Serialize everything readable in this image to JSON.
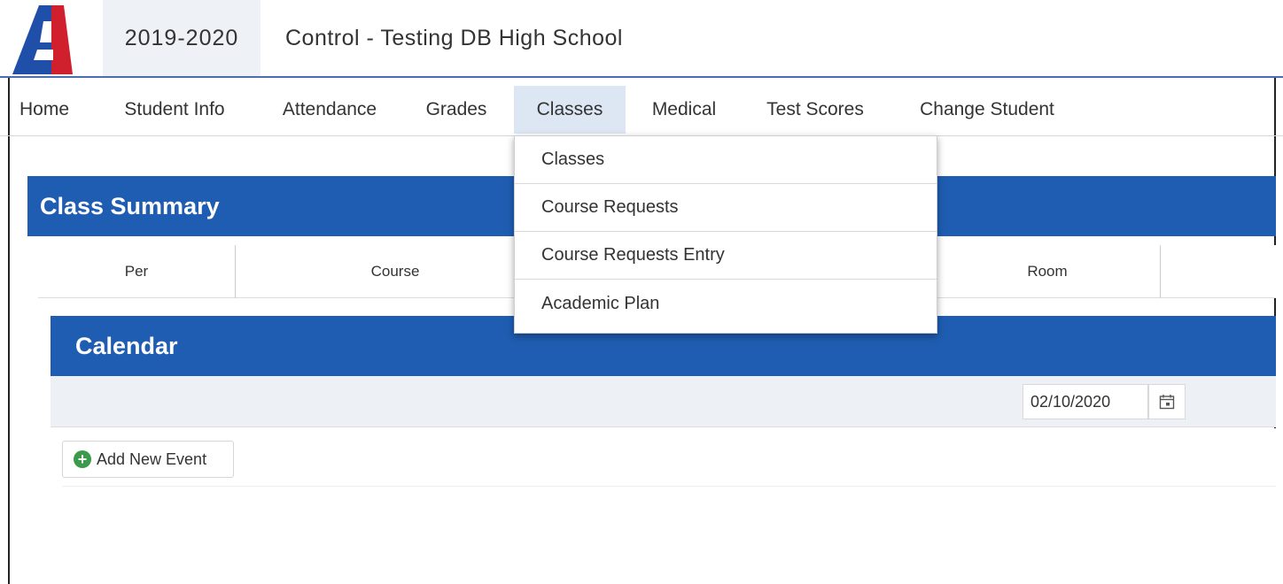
{
  "header": {
    "school_year": "2019-2020",
    "school_name": "Control - Testing DB High School"
  },
  "nav": {
    "items": [
      "Home",
      "Student Info",
      "Attendance",
      "Grades",
      "Classes",
      "Medical",
      "Test Scores",
      "Change Student"
    ],
    "active": "Classes"
  },
  "classes_menu": {
    "items": [
      "Classes",
      "Course Requests",
      "Course Requests Entry",
      "Academic Plan"
    ]
  },
  "class_summary": {
    "title": "Class Summary",
    "columns": [
      "Per",
      "Course",
      "Room"
    ]
  },
  "calendar": {
    "title": "Calendar",
    "date_value": "02/10/2020",
    "add_event_label": "Add New Event"
  },
  "colors": {
    "brand_blue": "#1f5db2",
    "brand_red": "#d0202e",
    "active_tab": "#dde6f3",
    "add_icon": "#3c9a4b"
  },
  "icons": {
    "logo": "aeries-logo",
    "date_picker": "calendar-icon",
    "add_event": "plus-circle-icon"
  }
}
